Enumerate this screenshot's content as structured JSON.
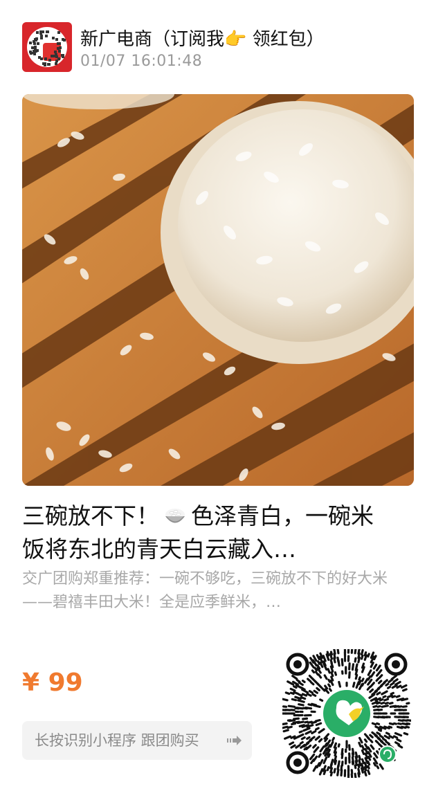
{
  "header": {
    "account_name": "新广电商（订阅我👉 领红包）",
    "post_time": "01/07 16:01:48"
  },
  "product": {
    "title_line1_a": "三碗放不下！",
    "title_line1_b": "色泽青白，一碗米",
    "title_line2": "饭将东北的青天白云藏入…",
    "description": "交广团购郑重推荐：一碗不够吃，三碗放不下的好大米——碧禧丰田大米！全是应季鲜米，…",
    "price": "¥ 99"
  },
  "cta": {
    "label": "长按识别小程序 跟团购买"
  },
  "icons": {
    "bowl": "rice-bowl-icon",
    "arrow": "arrow-right-icon",
    "qr": "mini-program-code-icon"
  },
  "colors": {
    "price": "#f07a2f",
    "avatar_bg": "#d8262b",
    "qr_logo": "#2aae67"
  }
}
